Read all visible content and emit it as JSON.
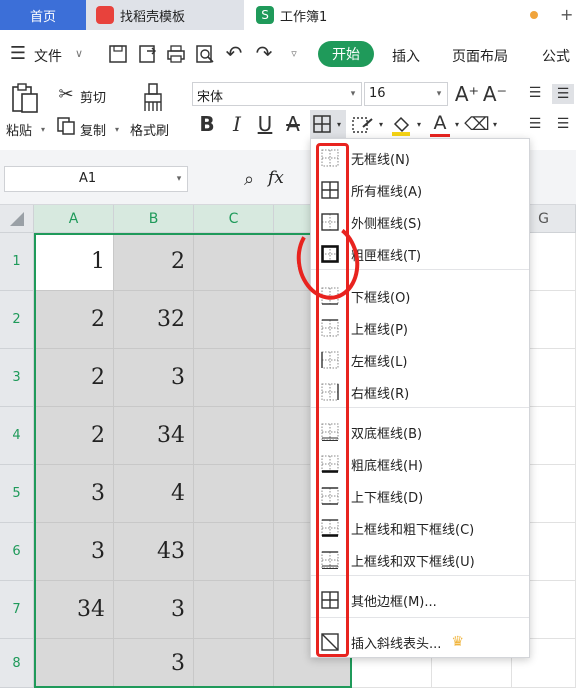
{
  "tabs": {
    "home": "首页",
    "template": "找稻壳模板",
    "workbook": "工作簿1",
    "workbook_icon": "S"
  },
  "menu": {
    "file": "文件",
    "start": "开始",
    "insert": "插入",
    "layout": "页面布局",
    "formula": "公式"
  },
  "ribbon": {
    "paste": "粘贴",
    "cut": "剪切",
    "copy": "复制",
    "format_painter": "格式刷",
    "font_name": "宋体",
    "font_size": "16",
    "bold": "B",
    "italic": "I",
    "underline": "U",
    "strike": "A",
    "font_color_glyph": "A"
  },
  "formula_bar": {
    "cell_ref": "A1",
    "fx": "fx"
  },
  "columns": [
    "A",
    "B",
    "C",
    "G"
  ],
  "rows": [
    {
      "num": "1",
      "a": "1",
      "b": "2"
    },
    {
      "num": "2",
      "a": "2",
      "b": "32"
    },
    {
      "num": "3",
      "a": "2",
      "b": "3"
    },
    {
      "num": "4",
      "a": "2",
      "b": "34"
    },
    {
      "num": "5",
      "a": "3",
      "b": "4"
    },
    {
      "num": "6",
      "a": "3",
      "b": "43"
    },
    {
      "num": "7",
      "a": "34",
      "b": "3"
    },
    {
      "num": "8",
      "a": "",
      "b": "3"
    }
  ],
  "border_menu": {
    "items": [
      "无框线(N)",
      "所有框线(A)",
      "外侧框线(S)",
      "粗匣框线(T)",
      "下框线(O)",
      "上框线(P)",
      "左框线(L)",
      "右框线(R)",
      "双底框线(B)",
      "粗底框线(H)",
      "上下框线(D)",
      "上框线和粗下框线(C)",
      "上框线和双下框线(U)",
      "其他边框(M)...",
      "插入斜线表头..."
    ]
  },
  "colors": {
    "accent_green": "#1f9a5a",
    "tab_blue": "#3c6fd8",
    "annotation_red": "#e8231f",
    "crown": "#f0b43c"
  }
}
